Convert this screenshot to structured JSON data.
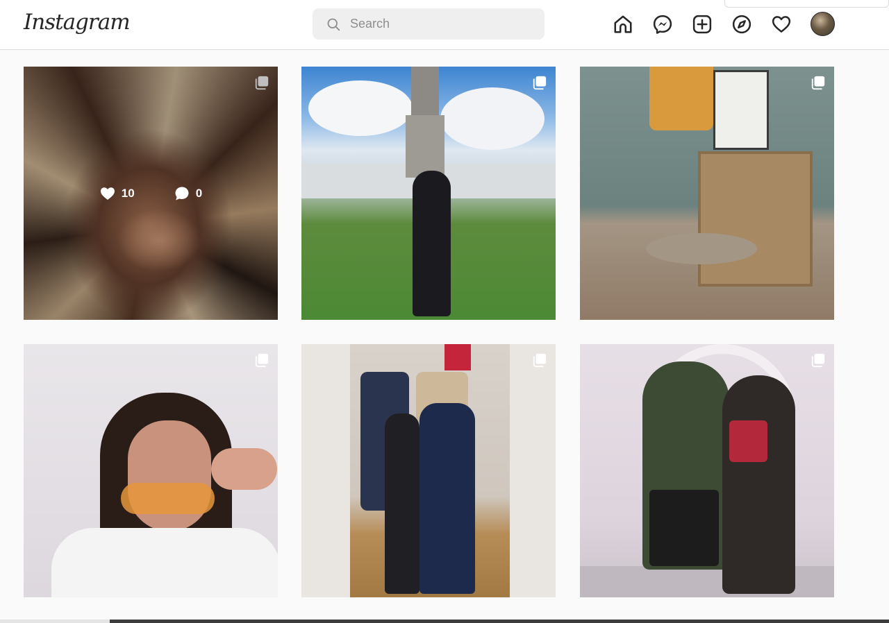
{
  "header": {
    "logo_text": "Instagram",
    "search_placeholder": "Search"
  },
  "nav_icons": [
    "home-icon",
    "messenger-icon",
    "new-post-icon",
    "explore-icon",
    "activity-heart-icon"
  ],
  "profile": {
    "avatar": "avatar"
  },
  "posts": [
    {
      "description": "mirror-shard-portrait",
      "likes": "10",
      "comments": "0",
      "multi": true,
      "hovered": true
    },
    {
      "description": "girl-in-front-of-church",
      "multi": true
    },
    {
      "description": "cafe-interior-lamp-shelf",
      "multi": true
    },
    {
      "description": "selfie-with-sunglasses",
      "multi": true
    },
    {
      "description": "mirror-selfie-in-store",
      "multi": true
    },
    {
      "description": "couple-under-white-arch",
      "multi": true
    }
  ],
  "colors": {
    "header_bg": "#ffffff",
    "page_bg": "#fafafa",
    "search_bg": "#efefef",
    "text_primary": "#262626",
    "text_secondary": "#8e8e8e",
    "border": "#dbdbdb"
  }
}
